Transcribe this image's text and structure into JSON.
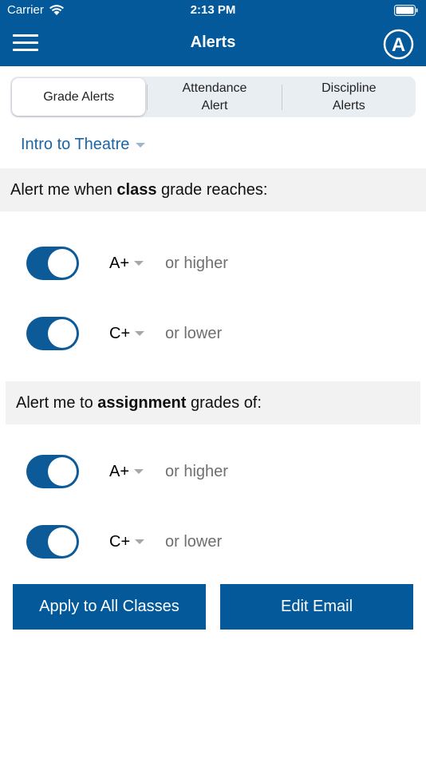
{
  "status_bar": {
    "carrier": "Carrier",
    "time": "2:13 PM"
  },
  "header": {
    "title": "Alerts",
    "logo_letter": "A"
  },
  "tabs": [
    {
      "label": "Grade Alerts",
      "active": true
    },
    {
      "label": "Attendance Alert",
      "active": false
    },
    {
      "label": "Discipline Alerts",
      "active": false
    }
  ],
  "class_selector": {
    "value": "Intro to Theatre"
  },
  "class_section": {
    "prefix": "Alert me when ",
    "bold": "class",
    "suffix": " grade reaches:",
    "rules": [
      {
        "enabled": true,
        "grade": "A+",
        "condition": "or higher"
      },
      {
        "enabled": true,
        "grade": "C+",
        "condition": "or lower"
      }
    ]
  },
  "assignment_section": {
    "prefix": "Alert me to ",
    "bold": "assignment",
    "suffix": " grades of:",
    "rules": [
      {
        "enabled": true,
        "grade": "A+",
        "condition": "or higher"
      },
      {
        "enabled": true,
        "grade": "C+",
        "condition": "or lower"
      }
    ]
  },
  "buttons": {
    "apply": "Apply to All Classes",
    "edit_email": "Edit Email"
  },
  "colors": {
    "primary": "#03599a",
    "toggle_on": "#0d5a99",
    "link": "#1c65a6",
    "section_bg": "#f2f2f2"
  }
}
